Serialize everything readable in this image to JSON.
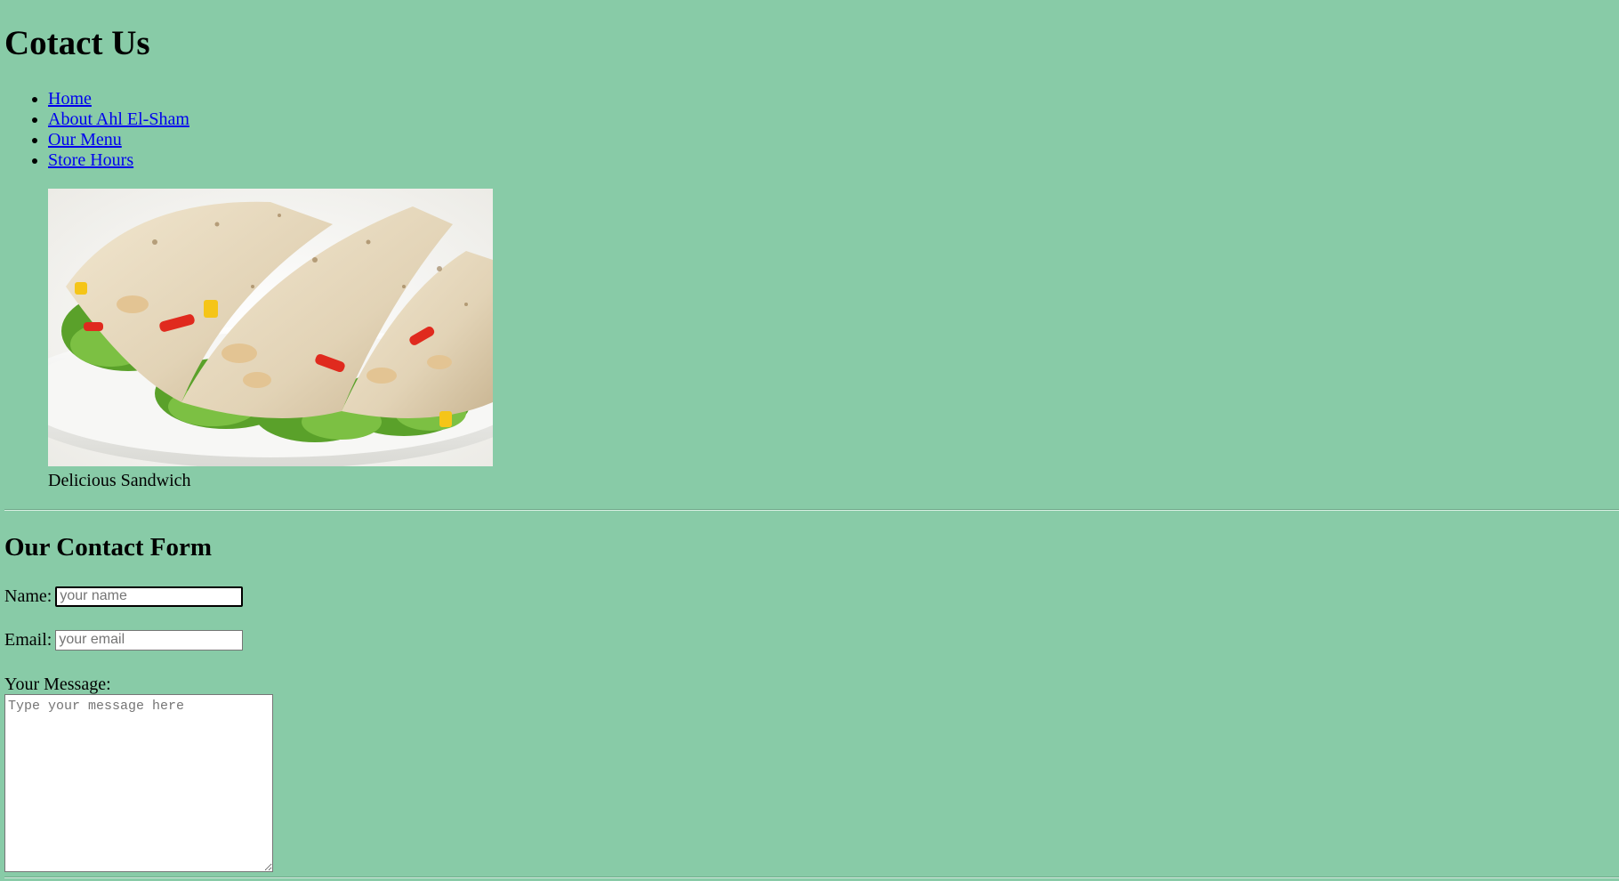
{
  "page_title": "Cotact Us",
  "nav": {
    "items": [
      {
        "label": "Home"
      },
      {
        "label": "About Ahl El-Sham"
      },
      {
        "label": "Our Menu"
      },
      {
        "label": "Store Hours"
      }
    ]
  },
  "photo": {
    "caption": "Delicious Sandwich",
    "subject": "chicken-wrap-sandwiches-on-plate"
  },
  "contact_form": {
    "heading": "Our Contact Form",
    "name_label": "Name:",
    "name_placeholder": "your name",
    "name_value": "",
    "email_label": "Email:",
    "email_placeholder": "your email",
    "email_value": "",
    "message_label": "Your Message:",
    "message_placeholder": "Type your message here",
    "message_value": ""
  },
  "colors": {
    "background": "#88cba7",
    "link": "#0000ee"
  }
}
